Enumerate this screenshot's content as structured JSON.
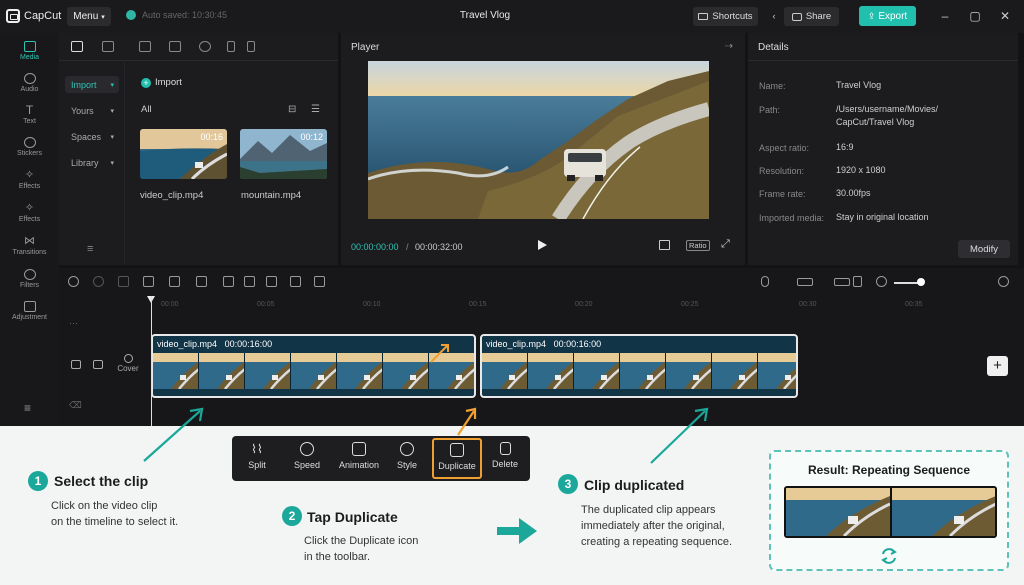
{
  "titlebar": {
    "app_name": "CapCut",
    "menu_label": "Menu",
    "autosave_text": "Auto saved: 10:30:45",
    "project_title": "Travel Vlog",
    "shortcuts_label": "Shortcuts",
    "share_label": "Share",
    "export_label": "Export"
  },
  "rail": {
    "items": [
      {
        "label": "Media",
        "icon": "media-icon"
      },
      {
        "label": "Audio",
        "icon": "audio-icon"
      },
      {
        "label": "Text",
        "icon": "text-icon"
      },
      {
        "label": "Stickers",
        "icon": "stickers-icon"
      },
      {
        "label": "Effects",
        "icon": "effects-icon"
      },
      {
        "label": "Effects",
        "icon": "effects-icon"
      },
      {
        "label": "Transitions",
        "icon": "transitions-icon"
      },
      {
        "label": "Filters",
        "icon": "filters-icon"
      },
      {
        "label": "Adjustment",
        "icon": "adjustment-icon"
      }
    ]
  },
  "media": {
    "sub_buttons": [
      "Import",
      "Yours",
      "Spaces",
      "Library"
    ],
    "import_label": "Import",
    "all_label": "All",
    "items": [
      {
        "name": "video_clip.mp4",
        "duration": "00:16"
      },
      {
        "name": "mountain.mp4",
        "duration": "00:12"
      }
    ]
  },
  "player": {
    "title": "Player",
    "current_time": "00:00:00:00",
    "separator": "/",
    "total_time": "00:00:32:00",
    "ratio_label": "Ratio"
  },
  "details": {
    "title": "Details",
    "rows": [
      {
        "label": "Name:",
        "value": "Travel Vlog"
      },
      {
        "label": "Path:",
        "value": "/Users/username/Movies/"
      },
      {
        "label": "",
        "value": "CapCut/Travel Vlog"
      },
      {
        "label": "Aspect ratio:",
        "value": "16:9"
      },
      {
        "label": "Resolution:",
        "value": "1920 x 1080"
      },
      {
        "label": "Frame rate:",
        "value": "30.00fps"
      },
      {
        "label": "Imported media:",
        "value": "Stay in original location"
      }
    ],
    "modify_label": "Modify"
  },
  "timeline": {
    "ruler": [
      "00:00",
      "00:05",
      "00:10",
      "00:15",
      "00:20",
      "00:25",
      "00:30",
      "00:35"
    ],
    "cover_label": "Cover",
    "clips": [
      {
        "name": "video_clip.mp4",
        "duration": "00:00:16:00"
      },
      {
        "name": "video_clip.mp4",
        "duration": "00:00:16:00"
      }
    ]
  },
  "float_toolbar": {
    "items": [
      {
        "label": "Split",
        "icon": "split-icon"
      },
      {
        "label": "Speed",
        "icon": "speed-icon"
      },
      {
        "label": "Animation",
        "icon": "animation-icon"
      },
      {
        "label": "Style",
        "icon": "style-icon"
      },
      {
        "label": "Duplicate",
        "icon": "duplicate-icon"
      },
      {
        "label": "Delete",
        "icon": "delete-icon"
      }
    ]
  },
  "steps": [
    {
      "num": "1",
      "title": "Select the clip",
      "desc1": "Click on the video clip",
      "desc2": "on the timeline to select it."
    },
    {
      "num": "2",
      "title": "Tap Duplicate",
      "desc1": "Click the Duplicate icon",
      "desc2": "in the toolbar."
    },
    {
      "num": "3",
      "title": "Clip duplicated",
      "desc1": "The duplicated clip appears",
      "desc2": "immediately after the original,",
      "desc3": "creating a repeating sequence."
    }
  ],
  "result": {
    "title": "Result: Repeating Sequence"
  },
  "colors": {
    "accent": "#21bfae",
    "highlight": "#f0a030",
    "step": "#1ba799"
  }
}
